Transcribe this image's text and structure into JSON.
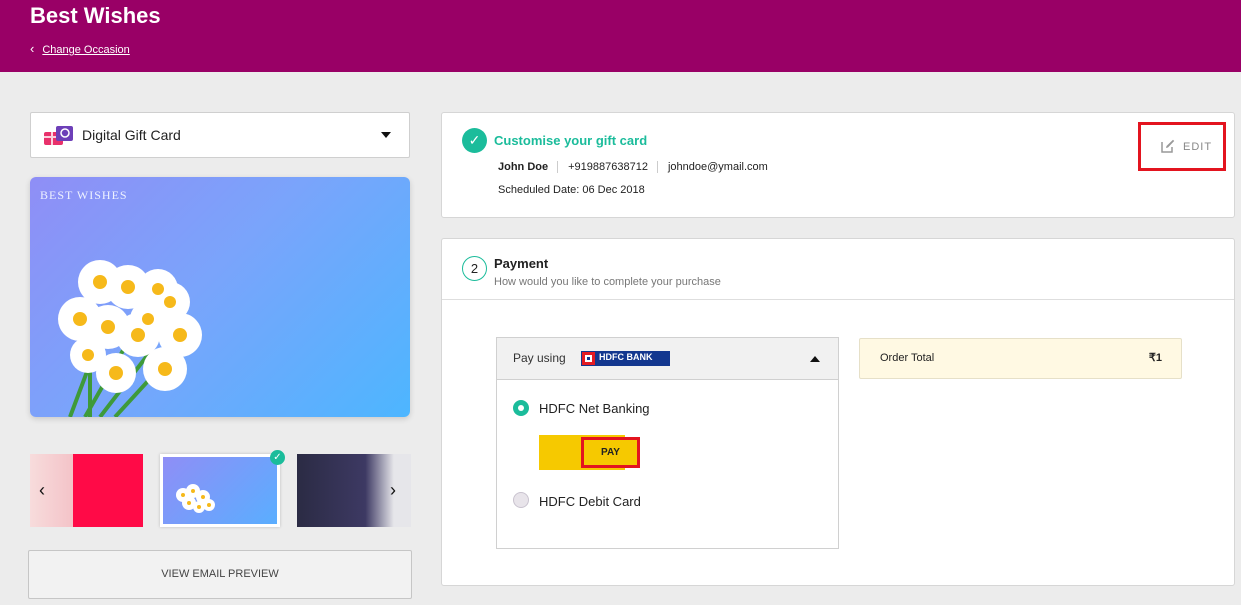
{
  "header": {
    "title": "Best Wishes",
    "back_label": "Change Occasion"
  },
  "card_type": {
    "selected": "Digital Gift Card"
  },
  "preview": {
    "card_text": "BEST WISHES"
  },
  "email_preview_label": "VIEW EMAIL PREVIEW",
  "summary": {
    "heading": "Customise your gift card",
    "recipient_name": "John Doe",
    "phone": "+919887638712",
    "email": "johndoe@ymail.com",
    "scheduled_date": "Scheduled Date: 06 Dec 2018",
    "edit_label": "EDIT"
  },
  "payment": {
    "step": "2",
    "heading": "Payment",
    "subheading": "How would you like to complete your purchase",
    "pay_using_label": "Pay using",
    "bank_logo_text": "HDFC BANK",
    "options": [
      {
        "label": "HDFC Net Banking",
        "selected": true
      },
      {
        "label": "HDFC Debit Card",
        "selected": false
      }
    ],
    "pay_button_label": "PAY",
    "order_total_label": "Order Total",
    "order_total_value": "₹1"
  },
  "colors": {
    "header_bg": "#990066",
    "accent_green": "#1bbc9b",
    "pay_yellow": "#f6c900",
    "highlight_red": "#e3141f"
  }
}
